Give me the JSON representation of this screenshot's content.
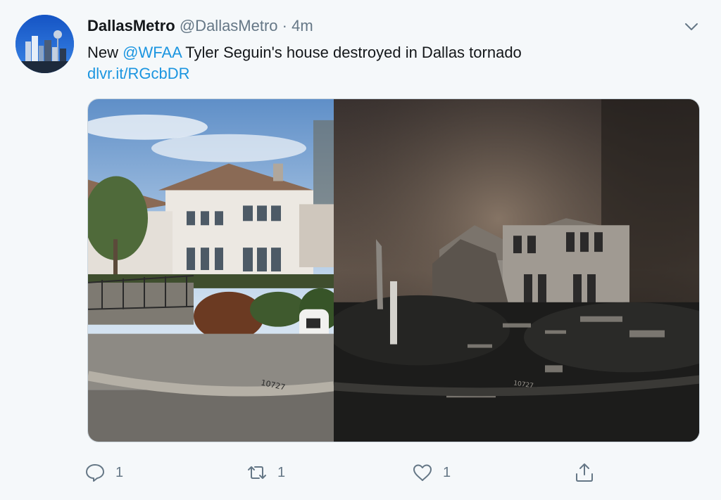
{
  "tweet": {
    "name": "DallasMetro",
    "handle": "@DallasMetro",
    "separator": "·",
    "time": "4m",
    "text_prefix": "New ",
    "mention": "@WFAA",
    "text_rest": " Tyler Seguin's house destroyed in Dallas tornado",
    "link": "dlvr.it/RGcbDR",
    "image_house_number": "10727"
  },
  "actions": {
    "reply_count": "1",
    "retweet_count": "1",
    "like_count": "1"
  },
  "colors": {
    "accent": "#1b95e0",
    "secondary_text": "#657786",
    "primary_text": "#14171a",
    "background": "#f5f8fa"
  },
  "icons": [
    "chevron-down-icon",
    "reply-icon",
    "retweet-icon",
    "like-icon",
    "share-icon"
  ]
}
